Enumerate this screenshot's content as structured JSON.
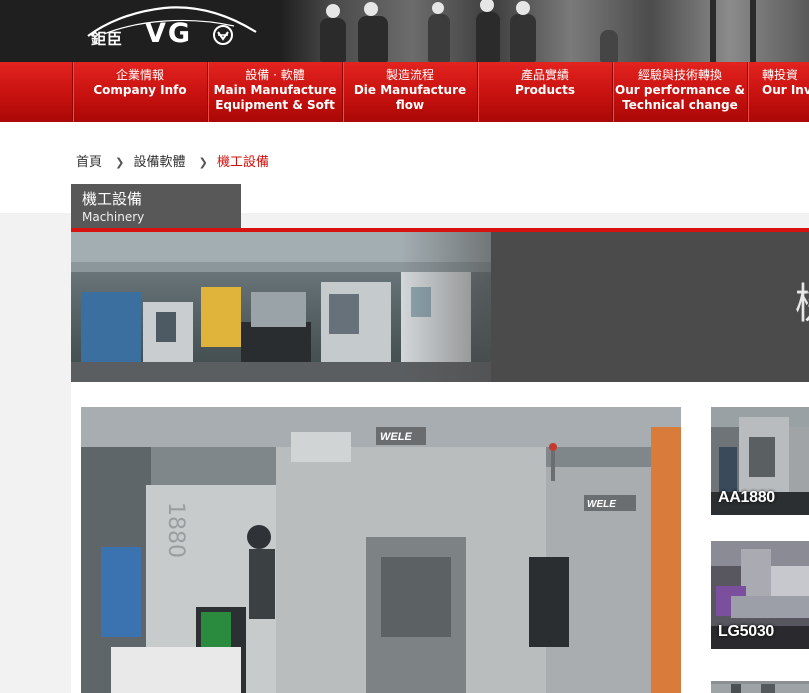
{
  "logo": {
    "chinese_name": "鉅臣",
    "brand": "VG"
  },
  "nav": [
    {
      "zh": "企業情報",
      "en": "Company Info"
    },
    {
      "zh": "設備 · 軟體",
      "en": "Main Manufacture Equipment & Soft"
    },
    {
      "zh": "製造流程",
      "en": "Die Manufacture flow"
    },
    {
      "zh": "產品實績",
      "en": "Products"
    },
    {
      "zh": "經驗與技術轉換",
      "en": "Our performance & Technical change"
    },
    {
      "zh": "轉投資",
      "en": "Our Inv... Pro..."
    }
  ],
  "breadcrumb": {
    "home": "首頁",
    "level1": "設備軟體",
    "current": "機工設備",
    "separator": "❯"
  },
  "section": {
    "title_zh": "機工設備",
    "title_en": "Machinery"
  },
  "banner": {
    "title_char": "機"
  },
  "main_photo": {
    "brand_text": "WELE",
    "model_text": "1880"
  },
  "thumbnails": [
    {
      "label": "AA1880"
    },
    {
      "label": "LG5030"
    }
  ],
  "colors": {
    "accent_red": "#d7120f",
    "nav_red": "#c4100e",
    "header_dark": "#1d1d1d",
    "tab_gray": "#585858"
  }
}
